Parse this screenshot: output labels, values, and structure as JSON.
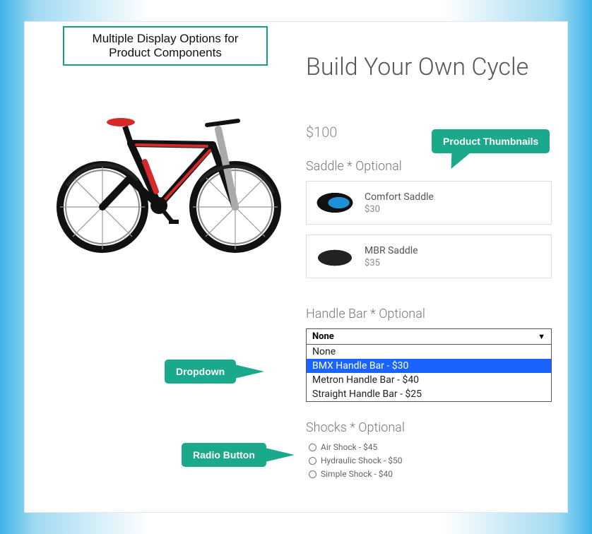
{
  "annotation": {
    "heading_l1": "Multiple Display Options for",
    "heading_l2": "Product Components",
    "callout_thumbnails": "Product Thumbnails",
    "callout_dropdown": "Dropdown",
    "callout_radio": "Radio Button"
  },
  "product": {
    "title": "Build Your Own Cycle",
    "price": "$100"
  },
  "saddle": {
    "label": "Saddle * Optional",
    "options": [
      {
        "name": "Comfort Saddle",
        "price": "$30"
      },
      {
        "name": "MBR Saddle",
        "price": "$35"
      }
    ]
  },
  "handlebar": {
    "label": "Handle Bar * Optional",
    "selected": "None",
    "options": [
      {
        "label": "None",
        "highlighted": false
      },
      {
        "label": "BMX Handle Bar - $30",
        "highlighted": true
      },
      {
        "label": "Metron Handle Bar - $40",
        "highlighted": false
      },
      {
        "label": "Straight Handle Bar - $25",
        "highlighted": false
      }
    ]
  },
  "shocks": {
    "label": "Shocks * Optional",
    "options": [
      {
        "label": "Air Shock - $45"
      },
      {
        "label": "Hydraulic Shock - $50"
      },
      {
        "label": "Simple Shock - $40"
      }
    ]
  }
}
